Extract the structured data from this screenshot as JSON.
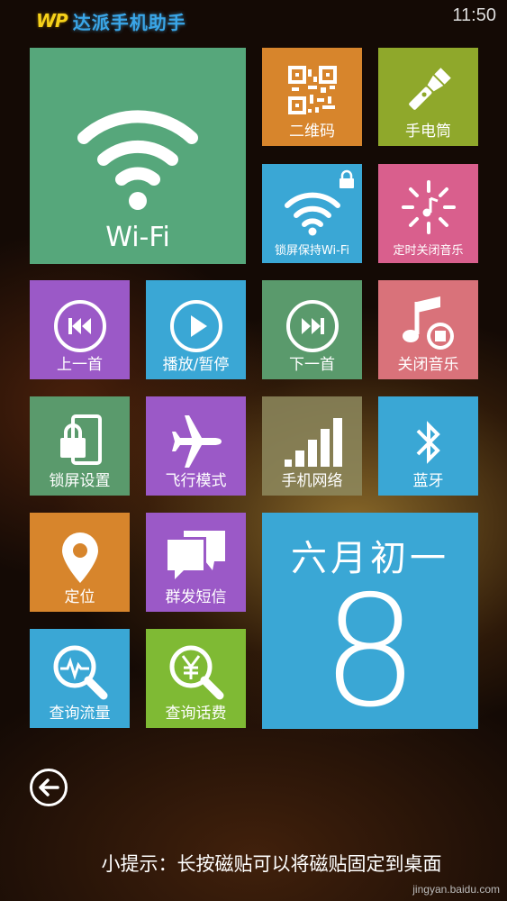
{
  "app": {
    "logo": "WP",
    "title": "达派手机助手",
    "time": "11:50"
  },
  "colors": {
    "green": "#56a77b",
    "orange": "#d7852c",
    "olive": "#8fa82b",
    "blue": "#3aa7d5",
    "pink": "#d95f8d",
    "purple": "#9b59c7",
    "salmon": "#d9727a",
    "tan": "#8e8a5e",
    "dark_green": "#5a9a6c",
    "lime": "#7fba34"
  },
  "tiles": {
    "wifi": "Wi-Fi",
    "qrcode": "二维码",
    "flashlight": "手电筒",
    "lock_wifi": "锁屏保持Wi-Fi",
    "timer_music": "定时关闭音乐",
    "prev": "上一首",
    "play_pause": "播放/暂停",
    "next": "下一首",
    "stop_music": "关闭音乐",
    "lock_settings": "锁屏设置",
    "airplane": "飞行模式",
    "network": "手机网络",
    "bluetooth": "蓝牙",
    "location": "定位",
    "group_sms": "群发短信",
    "query_data": "查询流量",
    "query_bill": "查询话费"
  },
  "calendar": {
    "lunar_month": "六月初一",
    "day": "8"
  },
  "hint": "小提示：长按磁贴可以将磁贴固定到桌面",
  "watermark": "jingyan.baidu.com"
}
